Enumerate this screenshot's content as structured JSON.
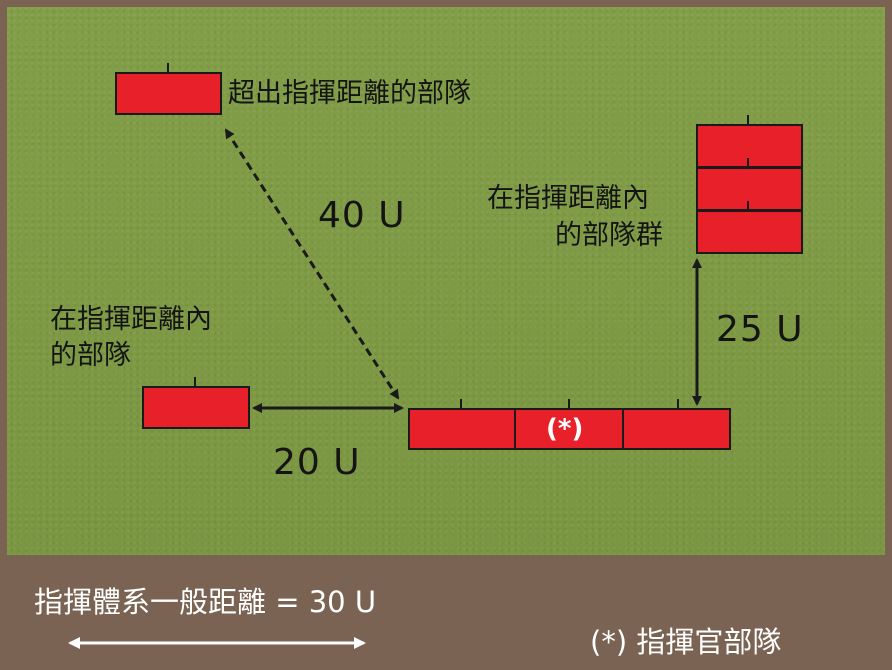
{
  "labels": {
    "out_of_range": "超出指揮距離的部隊",
    "in_range_left_line1": "在指揮距離內",
    "in_range_left_line2": "的部隊",
    "in_range_group_line1": "在指揮距離內",
    "in_range_group_line2": "的部隊群"
  },
  "distances": {
    "diagonal": "40 U",
    "horizontal": "20 U",
    "vertical": "25 U"
  },
  "general_marker": "(*)",
  "footer": {
    "general_distance": "指揮體系一般距離 = 30 U",
    "general_legend": "(*) 指揮官部隊"
  },
  "colors": {
    "unit_fill": "#e8202a",
    "field": "#7e9a45",
    "frame": "#7a6352"
  }
}
